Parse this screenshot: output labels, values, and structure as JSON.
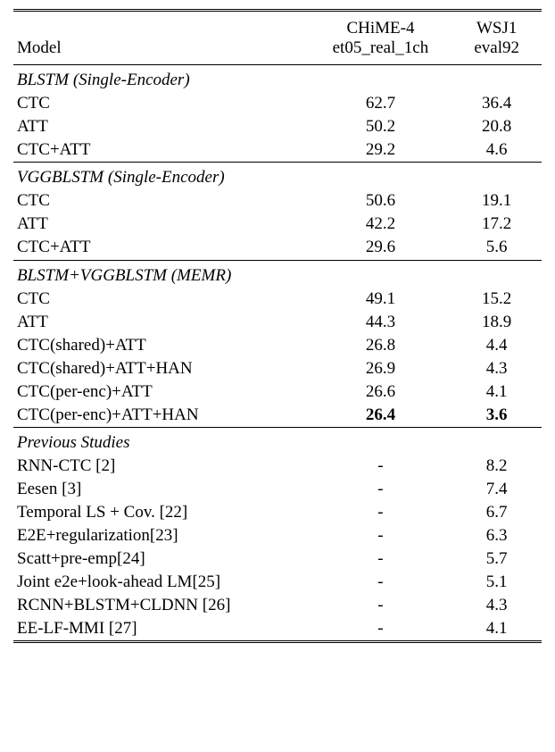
{
  "header": {
    "model_label": "Model",
    "col2_line1": "CHiME-4",
    "col2_line2": "et05_real_1ch",
    "col3_line1": "WSJ1",
    "col3_line2": "eval92"
  },
  "sections": [
    {
      "title": "BLSTM (Single-Encoder)",
      "rows": [
        {
          "model": "CTC",
          "chime": "62.7",
          "wsj": "36.4",
          "bold": false
        },
        {
          "model": "ATT",
          "chime": "50.2",
          "wsj": "20.8",
          "bold": false
        },
        {
          "model": "CTC+ATT",
          "chime": "29.2",
          "wsj": "4.6",
          "bold": false
        }
      ]
    },
    {
      "title": "VGGBLSTM (Single-Encoder)",
      "rows": [
        {
          "model": "CTC",
          "chime": "50.6",
          "wsj": "19.1",
          "bold": false
        },
        {
          "model": "ATT",
          "chime": "42.2",
          "wsj": "17.2",
          "bold": false
        },
        {
          "model": "CTC+ATT",
          "chime": "29.6",
          "wsj": "5.6",
          "bold": false
        }
      ]
    },
    {
      "title": "BLSTM+VGGBLSTM (MEMR)",
      "rows": [
        {
          "model": "CTC",
          "chime": "49.1",
          "wsj": "15.2",
          "bold": false
        },
        {
          "model": "ATT",
          "chime": "44.3",
          "wsj": "18.9",
          "bold": false
        },
        {
          "model": "CTC(shared)+ATT",
          "chime": "26.8",
          "wsj": "4.4",
          "bold": false
        },
        {
          "model": "CTC(shared)+ATT+HAN",
          "chime": "26.9",
          "wsj": "4.3",
          "bold": false
        },
        {
          "model": "CTC(per-enc)+ATT",
          "chime": "26.6",
          "wsj": "4.1",
          "bold": false
        },
        {
          "model": "CTC(per-enc)+ATT+HAN",
          "chime": "26.4",
          "wsj": "3.6",
          "bold": true
        }
      ]
    },
    {
      "title": "Previous Studies",
      "rows": [
        {
          "model": "RNN-CTC [2]",
          "chime": "-",
          "wsj": "8.2",
          "bold": false
        },
        {
          "model": "Eesen [3]",
          "chime": "-",
          "wsj": "7.4",
          "bold": false
        },
        {
          "model": "Temporal LS + Cov. [22]",
          "chime": "-",
          "wsj": "6.7",
          "bold": false
        },
        {
          "model": "E2E+regularization[23]",
          "chime": "-",
          "wsj": "6.3",
          "bold": false
        },
        {
          "model": "Scatt+pre-emp[24]",
          "chime": "-",
          "wsj": "5.7",
          "bold": false
        },
        {
          "model": "Joint e2e+look-ahead LM[25]",
          "chime": "-",
          "wsj": "5.1",
          "bold": false
        },
        {
          "model": "RCNN+BLSTM+CLDNN [26]",
          "chime": "-",
          "wsj": "4.3",
          "bold": false
        },
        {
          "model": "EE-LF-MMI [27]",
          "chime": "-",
          "wsj": "4.1",
          "bold": false
        }
      ]
    }
  ],
  "chart_data": {
    "type": "table",
    "title": "Model performance comparison",
    "columns": [
      "Model",
      "CHiME-4 et05_real_1ch",
      "WSJ1 eval92"
    ],
    "groups": [
      {
        "name": "BLSTM (Single-Encoder)",
        "rows": [
          [
            "CTC",
            62.7,
            36.4
          ],
          [
            "ATT",
            50.2,
            20.8
          ],
          [
            "CTC+ATT",
            29.2,
            4.6
          ]
        ]
      },
      {
        "name": "VGGBLSTM (Single-Encoder)",
        "rows": [
          [
            "CTC",
            50.6,
            19.1
          ],
          [
            "ATT",
            42.2,
            17.2
          ],
          [
            "CTC+ATT",
            29.6,
            5.6
          ]
        ]
      },
      {
        "name": "BLSTM+VGGBLSTM (MEMR)",
        "rows": [
          [
            "CTC",
            49.1,
            15.2
          ],
          [
            "ATT",
            44.3,
            18.9
          ],
          [
            "CTC(shared)+ATT",
            26.8,
            4.4
          ],
          [
            "CTC(shared)+ATT+HAN",
            26.9,
            4.3
          ],
          [
            "CTC(per-enc)+ATT",
            26.6,
            4.1
          ],
          [
            "CTC(per-enc)+ATT+HAN",
            26.4,
            3.6
          ]
        ]
      },
      {
        "name": "Previous Studies",
        "rows": [
          [
            "RNN-CTC [2]",
            null,
            8.2
          ],
          [
            "Eesen [3]",
            null,
            7.4
          ],
          [
            "Temporal LS + Cov. [22]",
            null,
            6.7
          ],
          [
            "E2E+regularization[23]",
            null,
            6.3
          ],
          [
            "Scatt+pre-emp[24]",
            null,
            5.7
          ],
          [
            "Joint e2e+look-ahead LM[25]",
            null,
            5.1
          ],
          [
            "RCNN+BLSTM+CLDNN [26]",
            null,
            4.3
          ],
          [
            "EE-LF-MMI [27]",
            null,
            4.1
          ]
        ]
      }
    ]
  }
}
